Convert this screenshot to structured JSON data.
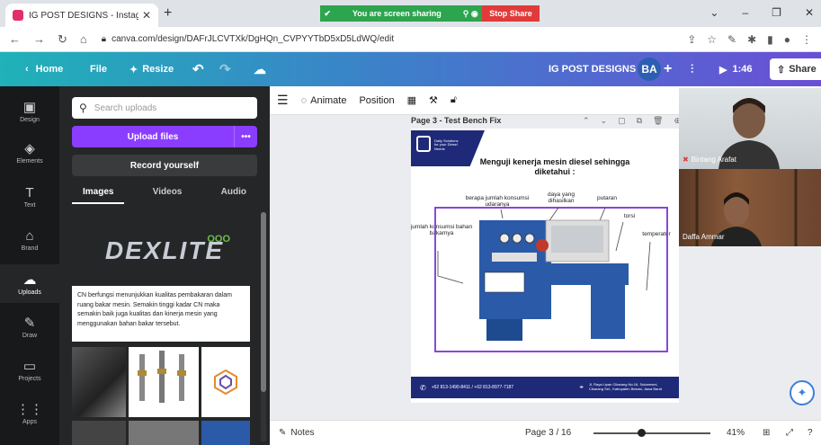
{
  "browser": {
    "tab_title": "IG POST DESIGNS - Instagram Po",
    "url": "canva.com/design/DAFrJLCVTXk/DgHQn_CVPYYTbD5xD5LdWQ/edit",
    "sharing_text": "You are screen sharing",
    "stop_share": "Stop Share"
  },
  "topbar": {
    "home": "Home",
    "file": "File",
    "resize": "Resize",
    "project_name": "IG POST DESIGNS",
    "avatar": "BA",
    "plus": "+",
    "timer": "1:46",
    "share": "Share"
  },
  "rail": [
    {
      "icon": "▣",
      "label": "Design"
    },
    {
      "icon": "◈",
      "label": "Elements"
    },
    {
      "icon": "T",
      "label": "Text"
    },
    {
      "icon": "⌂",
      "label": "Brand"
    },
    {
      "icon": "☁",
      "label": "Uploads"
    },
    {
      "icon": "✎",
      "label": "Draw"
    },
    {
      "icon": "▭",
      "label": "Projects"
    },
    {
      "icon": "⋮⋮",
      "label": "Apps"
    }
  ],
  "panel": {
    "search_placeholder": "Search uploads",
    "upload_files": "Upload files",
    "more": "•••",
    "record": "Record yourself",
    "tabs": [
      "Images",
      "Videos",
      "Audio"
    ],
    "dexlite_brand": "DEXLITE",
    "dexlite_mark": "OOO",
    "cn_text": "CN berfungsi menunjukkan kualitas pembakaran dalam ruang bakar mesin. Semakin tinggi kadar CN maka semakin baik juga kualitas dan kinerja mesin yang menggunakan bahan bakar tersebut."
  },
  "canvas_toolbar": {
    "animate": "Animate",
    "position": "Position"
  },
  "page": {
    "header": "Page 3 - Test Bench Fix",
    "logo_text": "Daily Solutions for your Diesel Needs",
    "title": "Menguji kenerja mesin diesel sehingga diketahui :",
    "labels": {
      "konsumsi": "berapa jumlah konsumsi udaranya",
      "daya": "daya yang dihasilkan",
      "putaran": "putaran",
      "torsi": "torsi",
      "bahan": "jumlah konsumsi bahan bakarnya",
      "temperatur": "temperatur"
    },
    "phone": "+62 813-1490-8411 / +62 813-8977-7187",
    "address": "Jl. Raya Lipan Cikarang No.16, Sukaresmi, Cikarang Sel., Kabupaten Bekasi, Jawa Barat"
  },
  "footer": {
    "notes": "Notes",
    "page_indicator": "Page 3 / 16",
    "zoom": "41%",
    "zoom_level": 0.41
  },
  "video": {
    "person1": "Bintang Arafat",
    "person2": "Daffa Ammar"
  },
  "colors": {
    "canva_purple": "#8b3dff",
    "brand_navy": "#1e2a78",
    "frame_purple": "#8a47d6",
    "machine_blue": "#2a5aa8"
  }
}
